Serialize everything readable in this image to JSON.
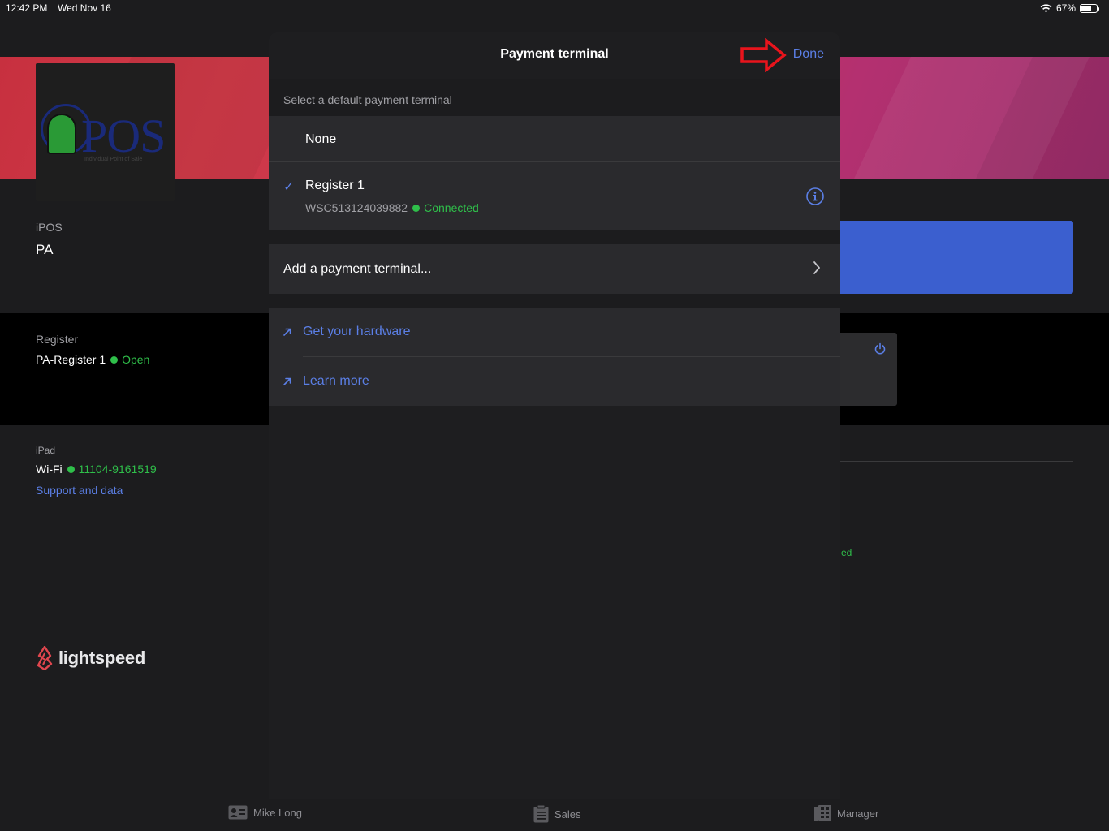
{
  "status_bar": {
    "time": "12:42 PM",
    "date": "Wed Nov 16",
    "battery": "67%",
    "battery_level": 0.67
  },
  "store": {
    "name_label": "iPOS",
    "name": "PA",
    "logo_text": "POS",
    "logo_subtitle": "Individual Point of Sale"
  },
  "register": {
    "label": "Register",
    "name": "PA-Register 1",
    "status": "Open"
  },
  "ipad": {
    "label": "iPad",
    "wifi_label": "Wi-Fi",
    "wifi_network": "11104-9161519",
    "support_link": "Support and data"
  },
  "background_fragment": {
    "faded_status": "ed"
  },
  "brand": {
    "name": "lightspeed"
  },
  "tabbar": {
    "tabs": [
      {
        "label": "Mike Long",
        "icon": "id-card-icon"
      },
      {
        "label": "Sales",
        "icon": "clipboard-icon"
      },
      {
        "label": "Manager",
        "icon": "building-icon"
      }
    ]
  },
  "modal": {
    "title": "Payment terminal",
    "done_label": "Done",
    "section_header": "Select a default payment terminal",
    "options": {
      "none_label": "None",
      "register_name": "Register 1",
      "register_serial": "WSC513124039882",
      "register_status": "Connected"
    },
    "add_terminal_label": "Add a payment terminal...",
    "links": {
      "hardware": "Get your hardware",
      "learn_more": "Learn more"
    }
  },
  "colors": {
    "accent_blue": "#5b7fe6",
    "status_green": "#2fbf4a",
    "annotation_red": "#e8141c"
  }
}
